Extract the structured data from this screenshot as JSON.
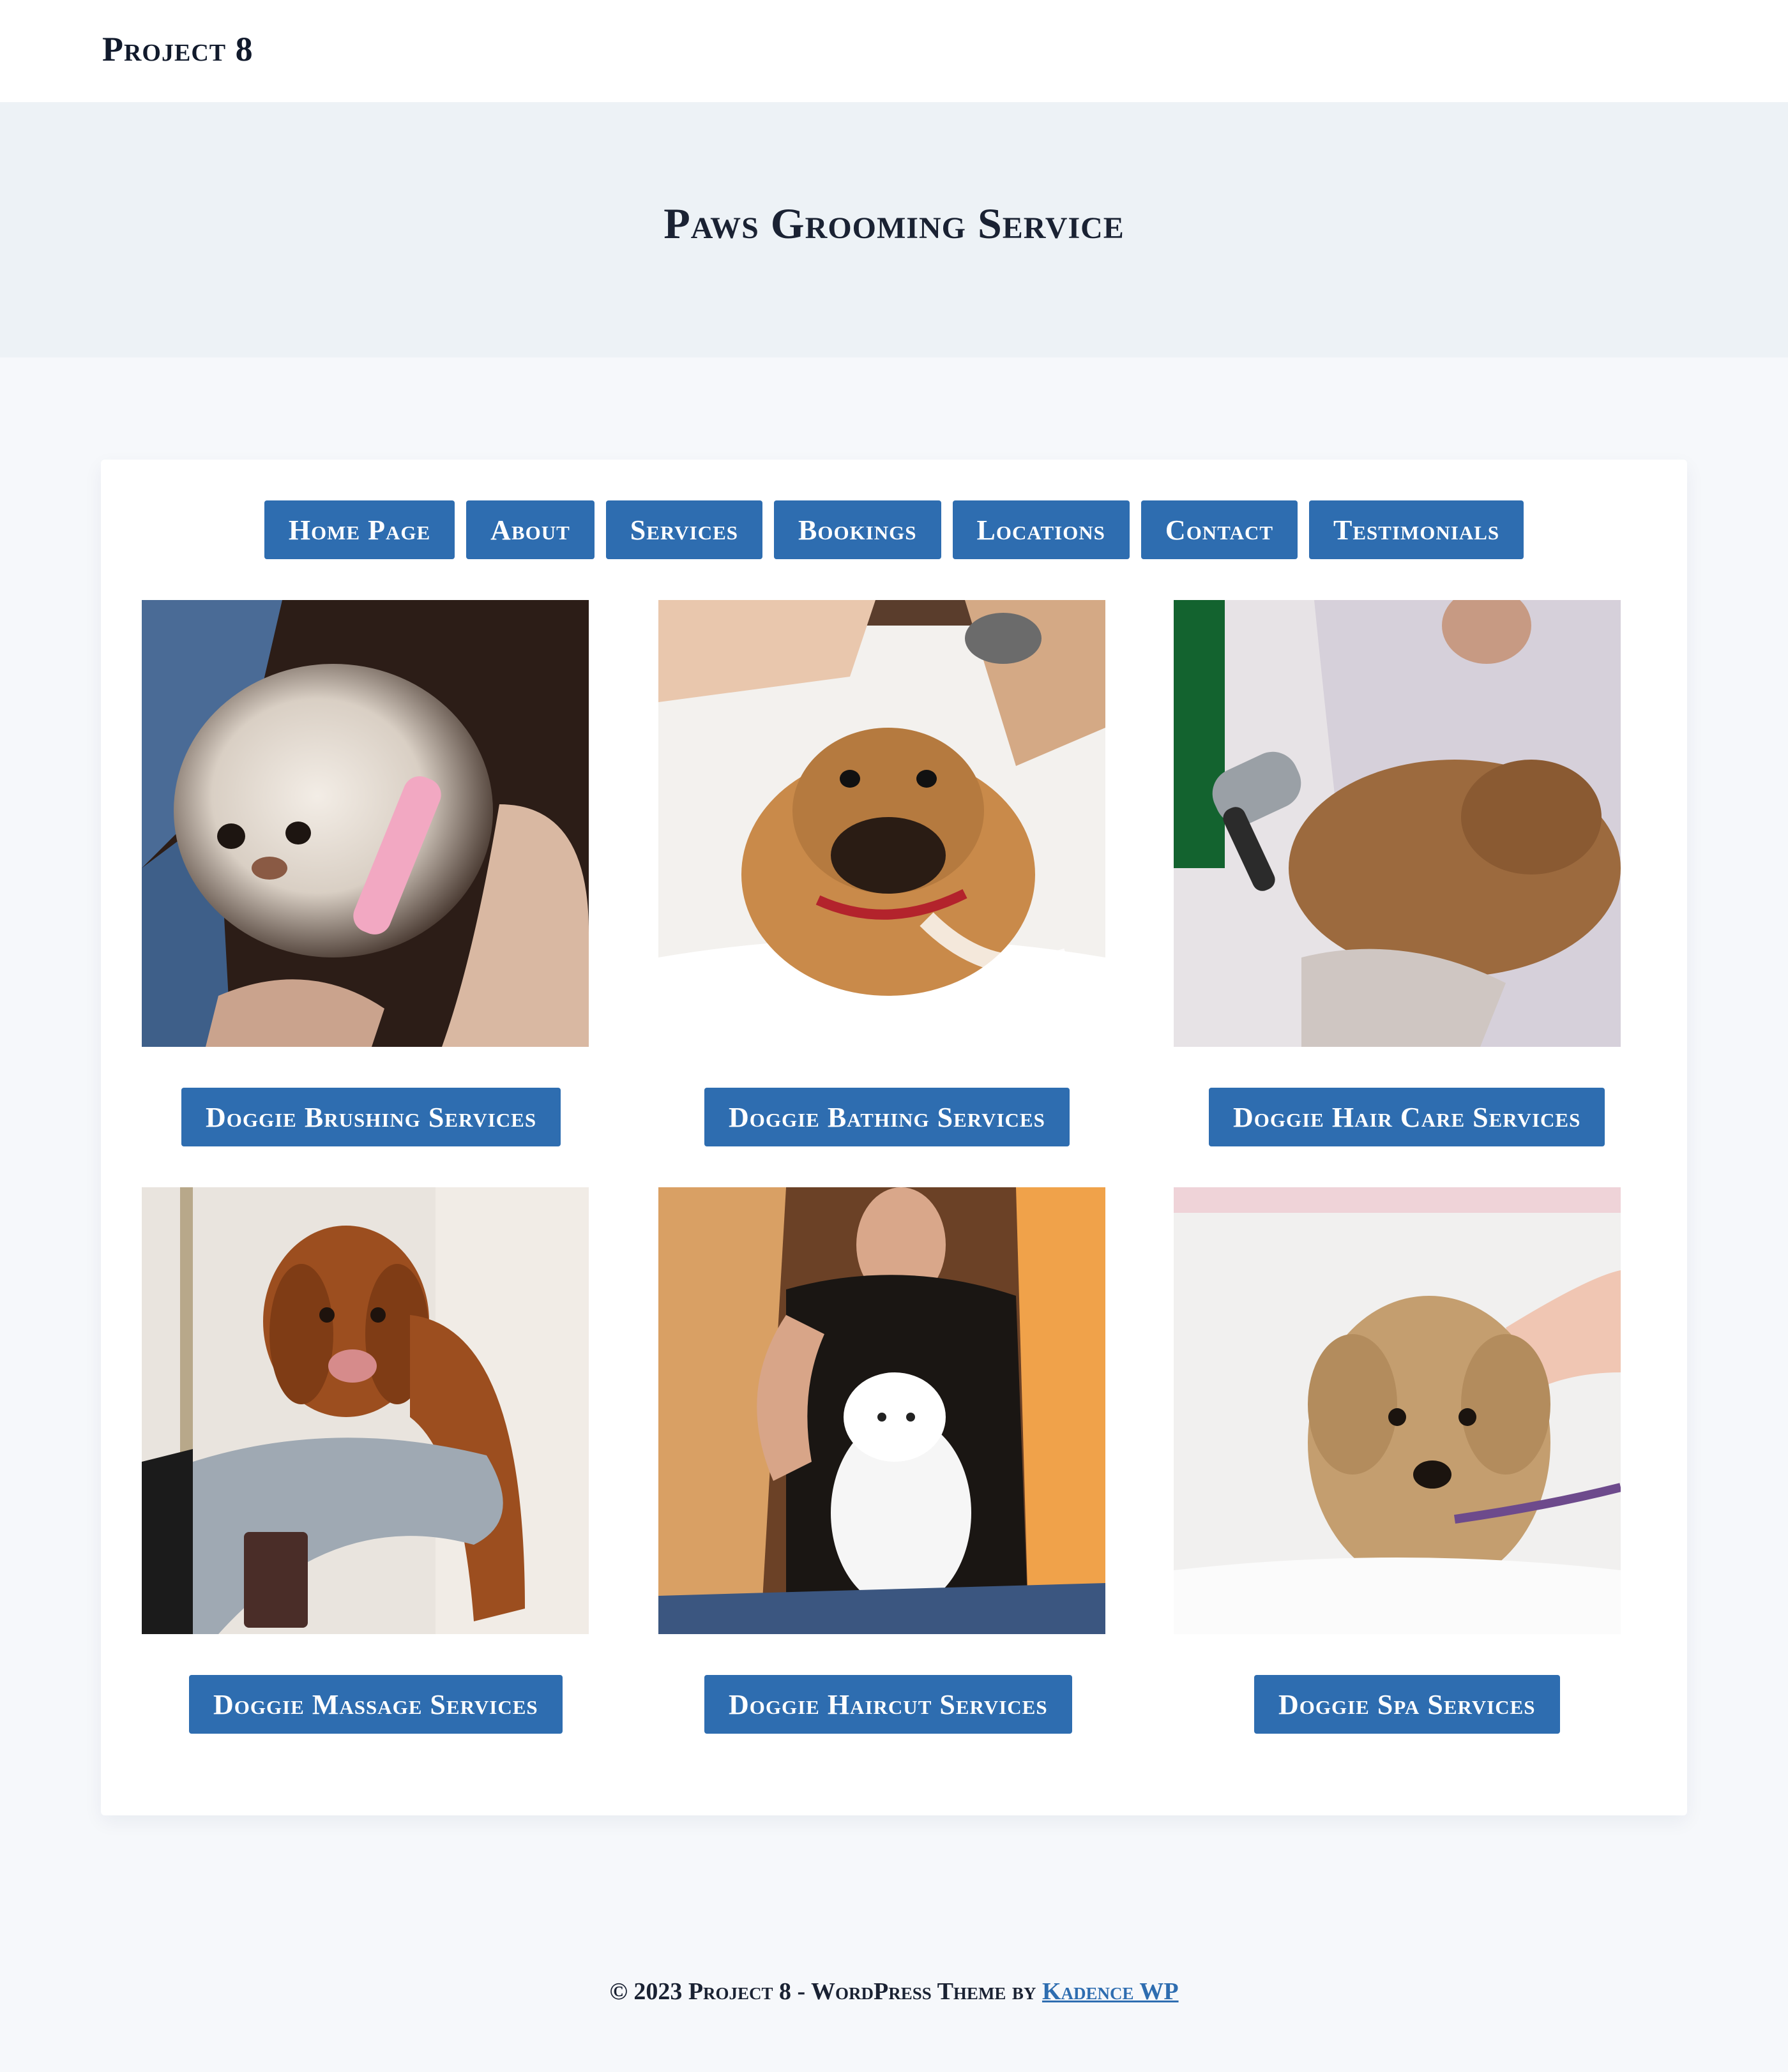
{
  "header": {
    "site_title": "Project 8"
  },
  "hero": {
    "title": "Paws Grooming Service"
  },
  "nav": {
    "items": [
      {
        "label": "Home Page"
      },
      {
        "label": "About"
      },
      {
        "label": "Services"
      },
      {
        "label": "Bookings"
      },
      {
        "label": "Locations"
      },
      {
        "label": "Contact"
      },
      {
        "label": "Testimonials"
      }
    ]
  },
  "services": [
    {
      "label": "Doggie Brushing Services",
      "image": "dog-being-brushed-photo"
    },
    {
      "label": "Doggie Bathing Services",
      "image": "bulldog-bath-photo"
    },
    {
      "label": "Doggie Hair Care Services",
      "image": "dog-blow-dry-photo"
    },
    {
      "label": "Doggie Massage Services",
      "image": "dog-towel-massage-photo"
    },
    {
      "label": "Doggie Haircut Services",
      "image": "groomer-combing-spitz-photo"
    },
    {
      "label": "Doggie Spa Services",
      "image": "wet-terrier-spa-photo"
    }
  ],
  "footer": {
    "copyright": "© 2023 Project 8 - WordPress Theme by ",
    "credit_link": "Kadence WP"
  },
  "colors": {
    "accent": "#2e6db0",
    "header_bg": "#ffffff",
    "hero_bg": "#edf2f6",
    "page_bg": "#f6f8fb",
    "text": "#1a2233"
  }
}
